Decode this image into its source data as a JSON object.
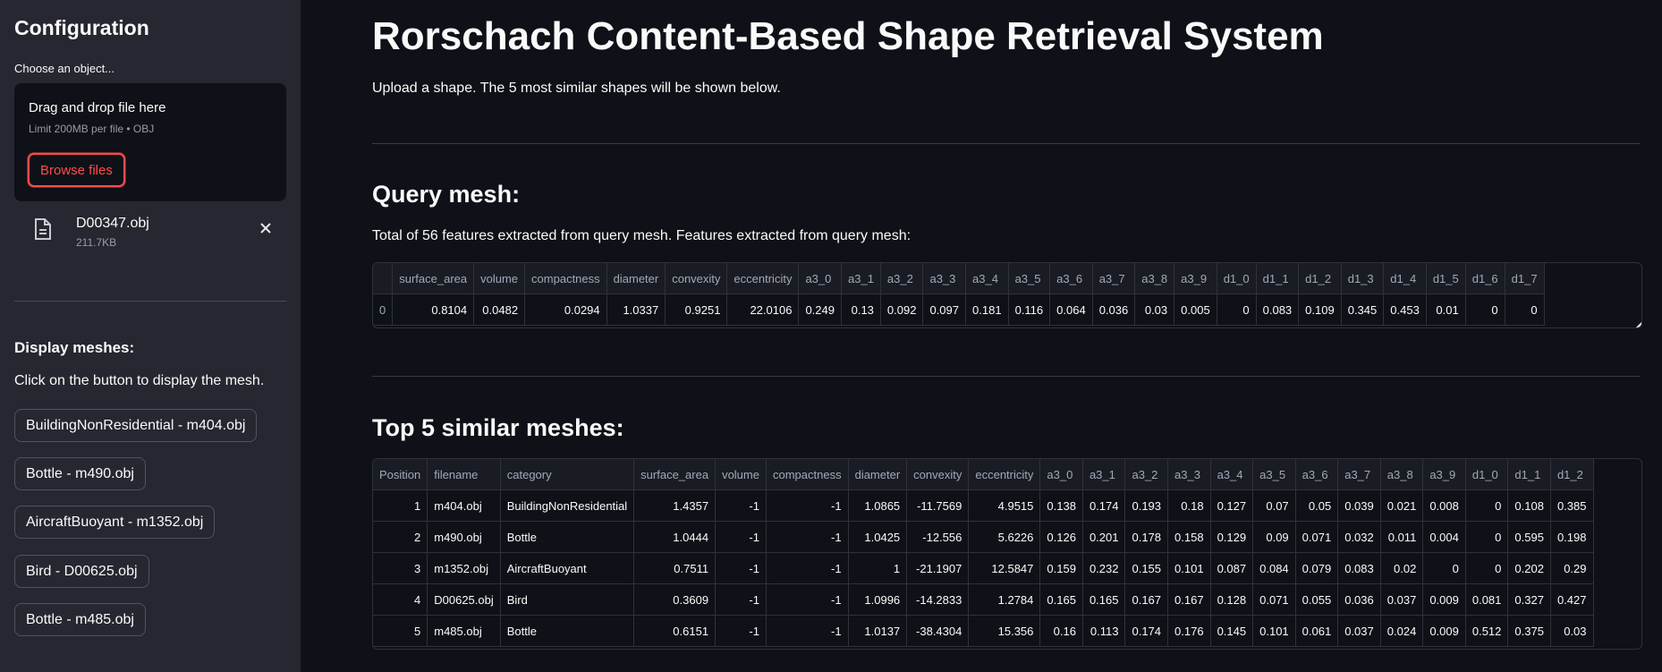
{
  "sidebar": {
    "title": "Configuration",
    "uploader": {
      "label": "Choose an object...",
      "drag_text": "Drag and drop file here",
      "limit_text": "Limit 200MB per file • OBJ",
      "browse_label": "Browse files"
    },
    "file": {
      "name": "D00347.obj",
      "size": "211.7KB",
      "icon": "file-icon"
    },
    "display_heading": "Display meshes:",
    "display_text": "Click on the button to display the mesh.",
    "buttons": [
      "BuildingNonResidential - m404.obj",
      "Bottle - m490.obj",
      "AircraftBuoyant - m1352.obj",
      "Bird - D00625.obj",
      "Bottle - m485.obj"
    ]
  },
  "main": {
    "title": "Rorschach Content-Based Shape Retrieval System",
    "description": "Upload a shape. The 5 most similar shapes will be shown below.",
    "query_heading": "Query mesh:",
    "query_text": "Total of 56 features extracted from query mesh. Features extracted from query mesh:",
    "query_table": {
      "columns": [
        "",
        "surface_area",
        "volume",
        "compactness",
        "diameter",
        "convexity",
        "eccentricity",
        "a3_0",
        "a3_1",
        "a3_2",
        "a3_3",
        "a3_4",
        "a3_5",
        "a3_6",
        "a3_7",
        "a3_8",
        "a3_9",
        "d1_0",
        "d1_1",
        "d1_2",
        "d1_3",
        "d1_4",
        "d1_5",
        "d1_6",
        "d1_7"
      ],
      "rows": [
        [
          "0",
          "0.8104",
          "0.0482",
          "0.0294",
          "1.0337",
          "0.9251",
          "22.0106",
          "0.249",
          "0.13",
          "0.092",
          "0.097",
          "0.181",
          "0.116",
          "0.064",
          "0.036",
          "0.03",
          "0.005",
          "0",
          "0.083",
          "0.109",
          "0.345",
          "0.453",
          "0.01",
          "0",
          "0"
        ]
      ]
    },
    "similar_heading": "Top 5 similar meshes:",
    "similar_table": {
      "columns": [
        "Position",
        "filename",
        "category",
        "surface_area",
        "volume",
        "compactness",
        "diameter",
        "convexity",
        "eccentricity",
        "a3_0",
        "a3_1",
        "a3_2",
        "a3_3",
        "a3_4",
        "a3_5",
        "a3_6",
        "a3_7",
        "a3_8",
        "a3_9",
        "d1_0",
        "d1_1",
        "d1_2"
      ],
      "rows": [
        [
          "1",
          "m404.obj",
          "BuildingNonResidential",
          "1.4357",
          "-1",
          "-1",
          "1.0865",
          "-11.7569",
          "4.9515",
          "0.138",
          "0.174",
          "0.193",
          "0.18",
          "0.127",
          "0.07",
          "0.05",
          "0.039",
          "0.021",
          "0.008",
          "0",
          "0.108",
          "0.385"
        ],
        [
          "2",
          "m490.obj",
          "Bottle",
          "1.0444",
          "-1",
          "-1",
          "1.0425",
          "-12.556",
          "5.6226",
          "0.126",
          "0.201",
          "0.178",
          "0.158",
          "0.129",
          "0.09",
          "0.071",
          "0.032",
          "0.011",
          "0.004",
          "0",
          "0.595",
          "0.198"
        ],
        [
          "3",
          "m1352.obj",
          "AircraftBuoyant",
          "0.7511",
          "-1",
          "-1",
          "1",
          "-21.1907",
          "12.5847",
          "0.159",
          "0.232",
          "0.155",
          "0.101",
          "0.087",
          "0.084",
          "0.079",
          "0.083",
          "0.02",
          "0",
          "0",
          "0.202",
          "0.29"
        ],
        [
          "4",
          "D00625.obj",
          "Bird",
          "0.3609",
          "-1",
          "-1",
          "1.0996",
          "-14.2833",
          "1.2784",
          "0.165",
          "0.165",
          "0.167",
          "0.167",
          "0.128",
          "0.071",
          "0.055",
          "0.036",
          "0.037",
          "0.009",
          "0.081",
          "0.327",
          "0.427"
        ],
        [
          "5",
          "m485.obj",
          "Bottle",
          "0.6151",
          "-1",
          "-1",
          "1.0137",
          "-38.4304",
          "15.356",
          "0.16",
          "0.113",
          "0.174",
          "0.176",
          "0.145",
          "0.101",
          "0.061",
          "0.037",
          "0.024",
          "0.009",
          "0.512",
          "0.375",
          "0.03"
        ]
      ]
    }
  }
}
